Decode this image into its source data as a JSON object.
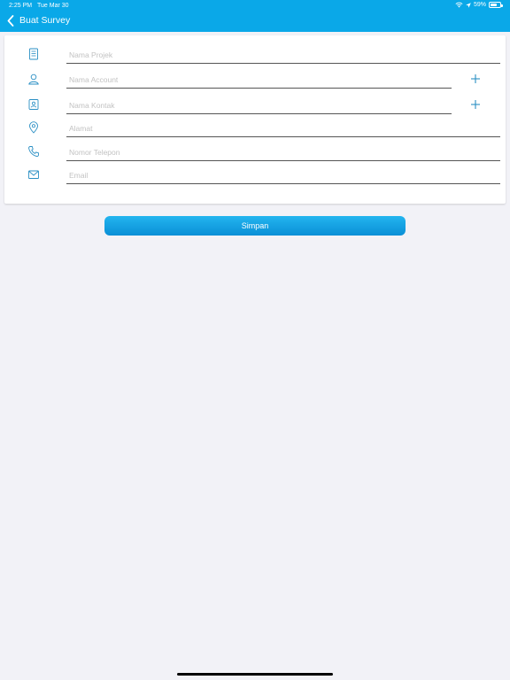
{
  "status_bar": {
    "time": "2:25 PM",
    "date": "Tue Mar 30",
    "battery": "59%"
  },
  "nav": {
    "title": "Buat Survey"
  },
  "form": {
    "project_name_placeholder": "Nama Projek",
    "account_name_placeholder": "Nama Account",
    "contact_name_placeholder": "Nama Kontak",
    "address_placeholder": "Alamat",
    "phone_placeholder": "Nomor Telepon",
    "email_placeholder": "Email"
  },
  "actions": {
    "save_label": "Simpan"
  },
  "colors": {
    "accent": "#0aa8e8",
    "icon": "#2a8fc4"
  }
}
